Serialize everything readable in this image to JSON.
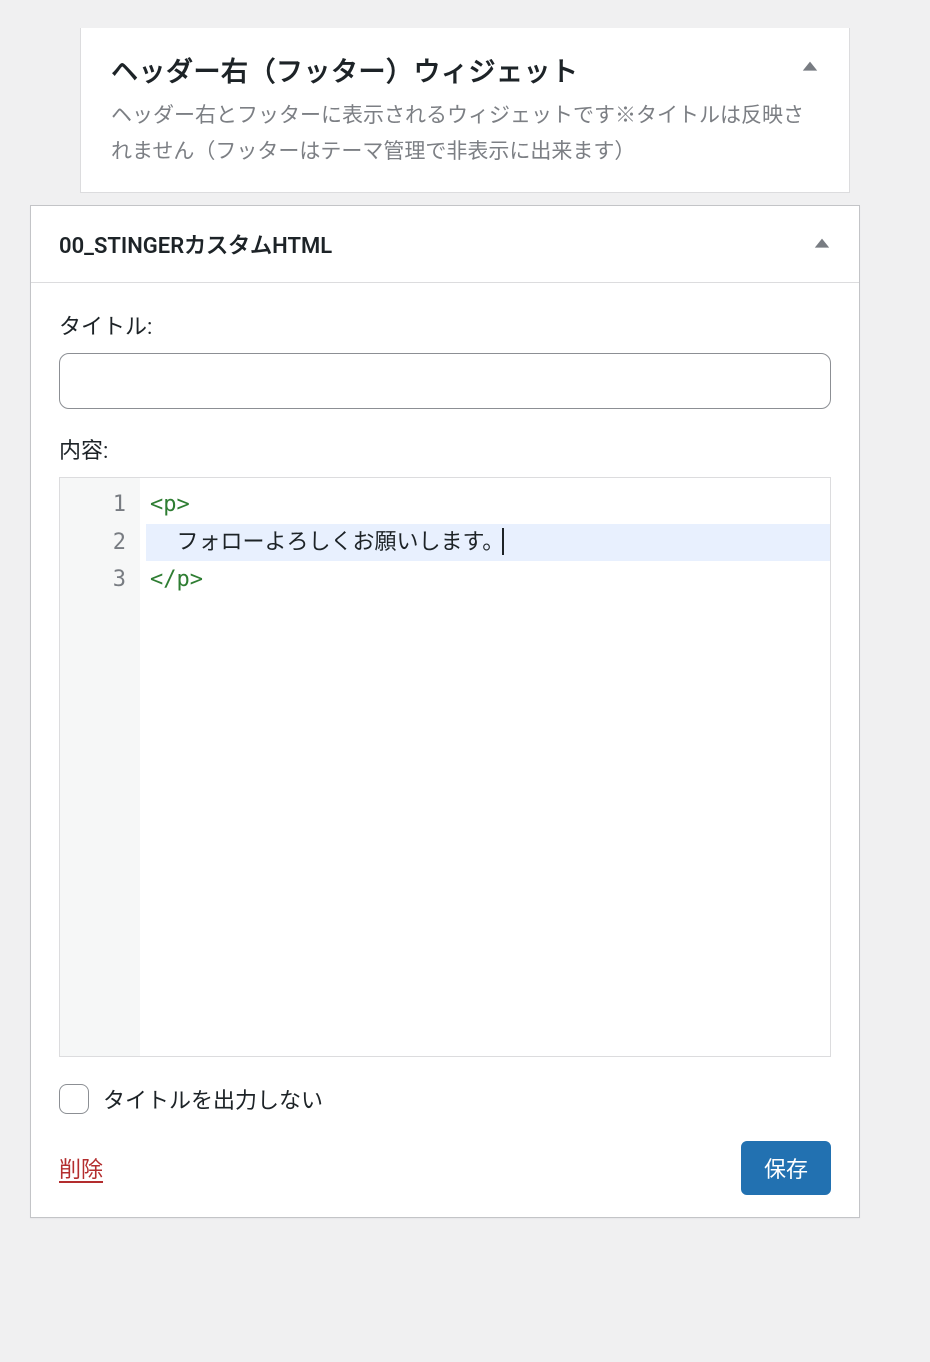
{
  "widget_area": {
    "title": "ヘッダー右（フッター）ウィジェット",
    "description": "ヘッダー右とフッターに表示されるウィジェットです※タイトルは反映されません（フッターはテーマ管理で非表示に出来ます）"
  },
  "widget": {
    "title": "00_STINGERカスタムHTML",
    "fields": {
      "title_label": "タイトル:",
      "title_value": "",
      "content_label": "内容:",
      "code_lines": {
        "l1_num": "1",
        "l2_num": "2",
        "l3_num": "3",
        "l1_tag": "<p>",
        "l2_text": "  フォローよろしくお願いします。",
        "l3_tag": "</p>"
      },
      "hide_title_label": "タイトルを出力しない"
    },
    "actions": {
      "delete": "削除",
      "save": "保存"
    }
  }
}
